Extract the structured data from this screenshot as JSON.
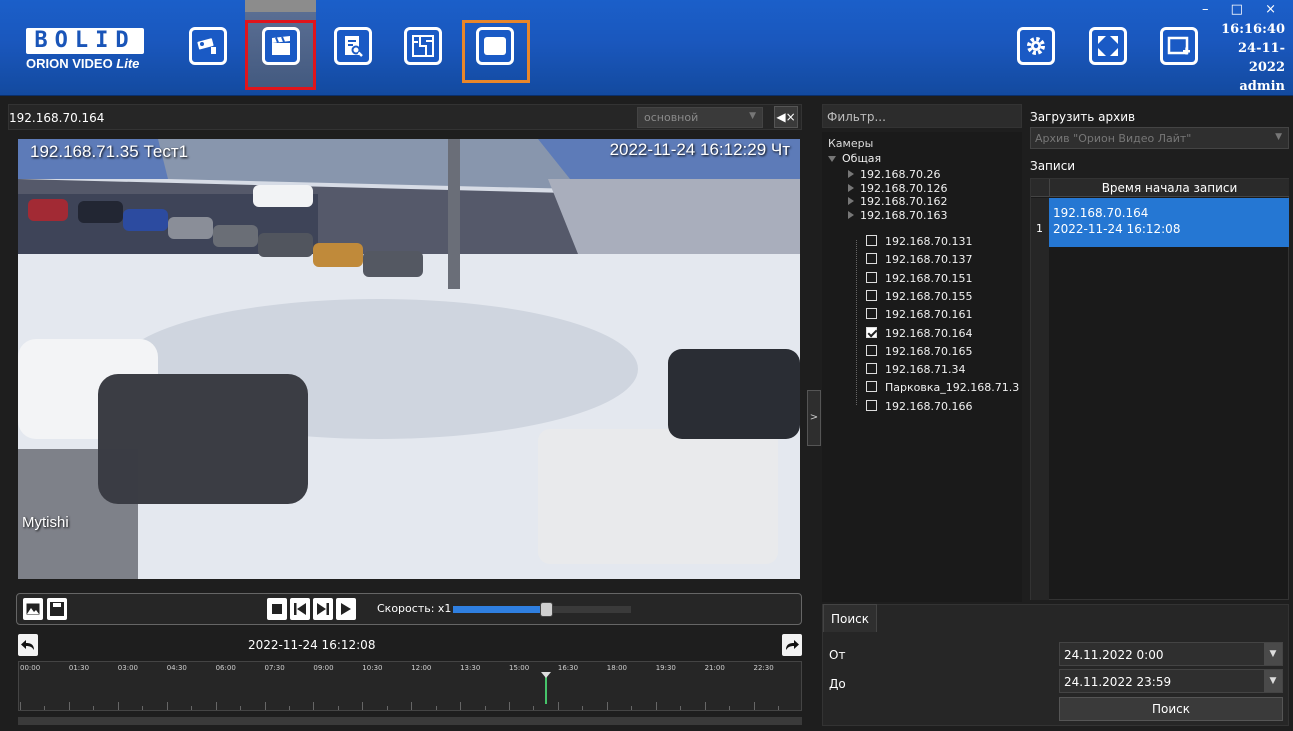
{
  "app": {
    "logo_main": "BOLID",
    "logo_sub_a": "ORION VIDEO ",
    "logo_sub_b": "Lite",
    "window_controls": "– □ ×",
    "time": "16:16:40",
    "date": "24-11-2022",
    "user": "admin"
  },
  "toolbar": {
    "left_icons": [
      "camera-icon",
      "clapperboard-icon",
      "document-search-icon",
      "floor-plan-icon",
      "monitor-icon"
    ],
    "right_icons": [
      "settings-icon",
      "fullscreen-icon",
      "add-window-icon"
    ],
    "active": "clapperboard-icon"
  },
  "player": {
    "camera_ip": "192.168.70.164",
    "stream": "основной",
    "osd_camera": "192.168.71.35  Тест1",
    "osd_datetime": "2022-11-24 16:12:29 Чт",
    "osd_location": "Mytishi",
    "speed_label": "Скорость: x1",
    "speed_level": 0.5,
    "nav_datetime": "2022-11-24 16:12:08",
    "timeline_labels": [
      "00:00",
      "01:30",
      "03:00",
      "04:30",
      "06:00",
      "07:30",
      "09:00",
      "10:30",
      "12:00",
      "13:30",
      "15:00",
      "16:30",
      "18:00",
      "19:30",
      "21:00",
      "22:30"
    ],
    "timeline_cursor": "16:12"
  },
  "cameras": {
    "filter_placeholder": "Фильтр...",
    "header": "Камеры",
    "group": "Общая",
    "collapsed": [
      "192.168.70.26",
      "192.168.70.126",
      "192.168.70.162",
      "192.168.70.163"
    ],
    "items": [
      {
        "label": "192.168.70.131",
        "checked": false
      },
      {
        "label": "192.168.70.137",
        "checked": false
      },
      {
        "label": "192.168.70.151",
        "checked": false
      },
      {
        "label": "192.168.70.155",
        "checked": false
      },
      {
        "label": "192.168.70.161",
        "checked": false
      },
      {
        "label": "192.168.70.164",
        "checked": true
      },
      {
        "label": "192.168.70.165",
        "checked": false
      },
      {
        "label": "192.168.71.34",
        "checked": false
      },
      {
        "label": "Парковка_192.168.71.3",
        "checked": false
      },
      {
        "label": "192.168.70.166",
        "checked": false
      }
    ]
  },
  "archive": {
    "load_label": "Загрузить архив",
    "selected": "Архив \"Орион Видео Лайт\"",
    "records_label": "Записи",
    "column_header": "Время начала записи",
    "rows": [
      {
        "num": "1",
        "camera": "192.168.70.164",
        "start": "2022-11-24 16:12:08"
      }
    ]
  },
  "search": {
    "tab": "Поиск",
    "from_label": "От",
    "from_value": "24.11.2022 0:00",
    "to_label": "До",
    "to_value": "24.11.2022 23:59",
    "button": "Поиск"
  },
  "colors": {
    "topbar": "#1a57bd",
    "accent": "#2577d3",
    "highlight_red": "#e0141c",
    "highlight_orange": "#e8862a"
  }
}
